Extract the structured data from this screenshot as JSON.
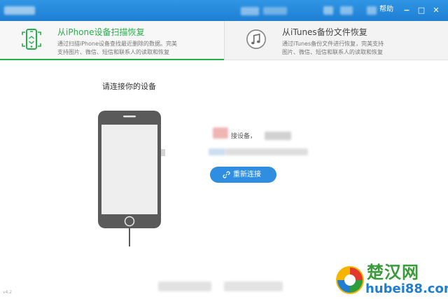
{
  "titlebar": {
    "help_label": "帮助",
    "minimize_glyph": "−",
    "maximize_glyph": "□",
    "close_glyph": "✕"
  },
  "tabs": [
    {
      "title": "从iPhone设备扫描恢复",
      "desc_line1": "通过扫描iPhone设备查找最近删除的数据。完美",
      "desc_line2": "支持图片、微信、短信和联系人的读取和恢复",
      "icon": "phone-scan-icon",
      "active": true
    },
    {
      "title": "从iTunes备份文件恢复",
      "desc_line1": "通过iTunes备份文件进行恢复，完美支持",
      "desc_line2": "图片、微信、短信和联系人的读取和恢复",
      "icon": "music-note-icon",
      "active": false
    }
  ],
  "main": {
    "heading": "请连接你的设备",
    "status_text": "接设备，",
    "reconnect_label": "重新连接",
    "version": "v4.2"
  },
  "watermark": {
    "cn": "楚汉网",
    "url": "hubei88.com"
  },
  "colors": {
    "titlebar": "#2a8ddf",
    "accent_green": "#23b04a",
    "button_blue": "#2f8ee0",
    "phone_gray": "#5a5a5a"
  }
}
